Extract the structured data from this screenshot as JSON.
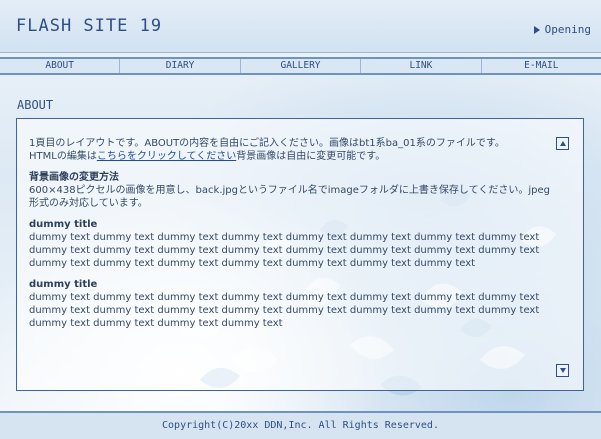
{
  "header": {
    "site_title": "FLASH SITE 19",
    "opening_label": "Opening"
  },
  "nav": [
    "ABOUT",
    "DIARY",
    "GALLERY",
    "LINK",
    "E-MAIL"
  ],
  "section_title": "ABOUT",
  "content": {
    "intro_line1": "1頁目のレイアウトです。ABOUTの内容を自由にご記入ください。画像はbt1系ba_01系のファイルです。",
    "intro_line2_prefix": "HTMLの編集は",
    "intro_link": "こちらをクリックしてください",
    "intro_line2_suffix": "背景画像は自由に変更可能です。",
    "subtitle": "背景画像の変更方法",
    "sub_text": "600×438ピクセルの画像を用意し、back.jpgというファイル名でimageフォルダに上書き保存してください。jpeg形式のみ対応しています。",
    "dummy_title_1": "dummy title",
    "dummy_text_1": "dummy text dummy text dummy text dummy text dummy text dummy text dummy text dummy text dummy text dummy text dummy text dummy text dummy text dummy text dummy text dummy text dummy text dummy text dummy text dummy text dummy text dummy text dummy text",
    "dummy_title_2": "dummy title",
    "dummy_text_2": "dummy text dummy text dummy text dummy text dummy text dummy text dummy text dummy text dummy text dummy text dummy text dummy text dummy text dummy text dummy text dummy text dummy text dummy text dummy text dummy text"
  },
  "footer": "Copyright(C)20xx DDN,Inc. All Rights Reserved.",
  "colors": {
    "accent": "#2d4f86",
    "border": "#6f93bf",
    "panel_border": "#3f6498"
  },
  "icons": {
    "opening": "triangle-right-icon",
    "scroll_up": "arrow-up-icon",
    "scroll_down": "arrow-down-icon"
  }
}
